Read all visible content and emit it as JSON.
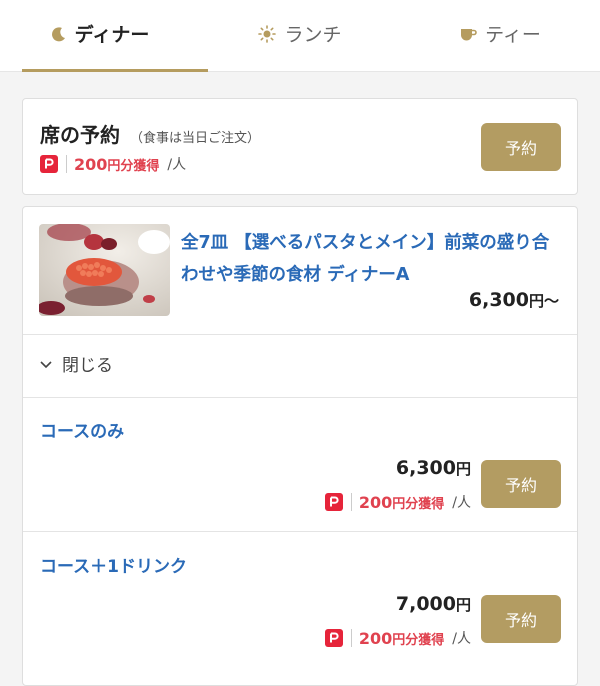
{
  "tabs": [
    {
      "label": "ディナー",
      "icon": "moon-icon",
      "active": true
    },
    {
      "label": "ランチ",
      "icon": "sun-icon",
      "active": false
    },
    {
      "label": "ティー",
      "icon": "teacup-icon",
      "active": false
    }
  ],
  "seat": {
    "title": "席の予約",
    "note": "（食事は当日ご注文）",
    "reserve_label": "予約",
    "paypay": {
      "amount": "200",
      "unit": "円分獲得",
      "per": "/人"
    }
  },
  "course": {
    "title": "全7皿 【選べるパスタとメイン】前菜の盛り合わせや季節の食材 ディナーA",
    "price": "6,300",
    "price_suffix": "円〜",
    "toggle_label": "閉じる",
    "plans": [
      {
        "name": "コースのみ",
        "price": "6,300",
        "yen": "円",
        "paypay_amount": "200",
        "paypay_unit": "円分獲得",
        "per": "/人",
        "reserve_label": "予約"
      },
      {
        "name": "コース＋1ドリンク",
        "price": "7,000",
        "yen": "円",
        "paypay_amount": "200",
        "paypay_unit": "円分獲得",
        "per": "/人",
        "reserve_label": "予約"
      }
    ]
  },
  "colors": {
    "accent": "#b39c62",
    "link": "#2a6ab7",
    "paypay_red": "#e6243a",
    "points": "#e0424f"
  }
}
